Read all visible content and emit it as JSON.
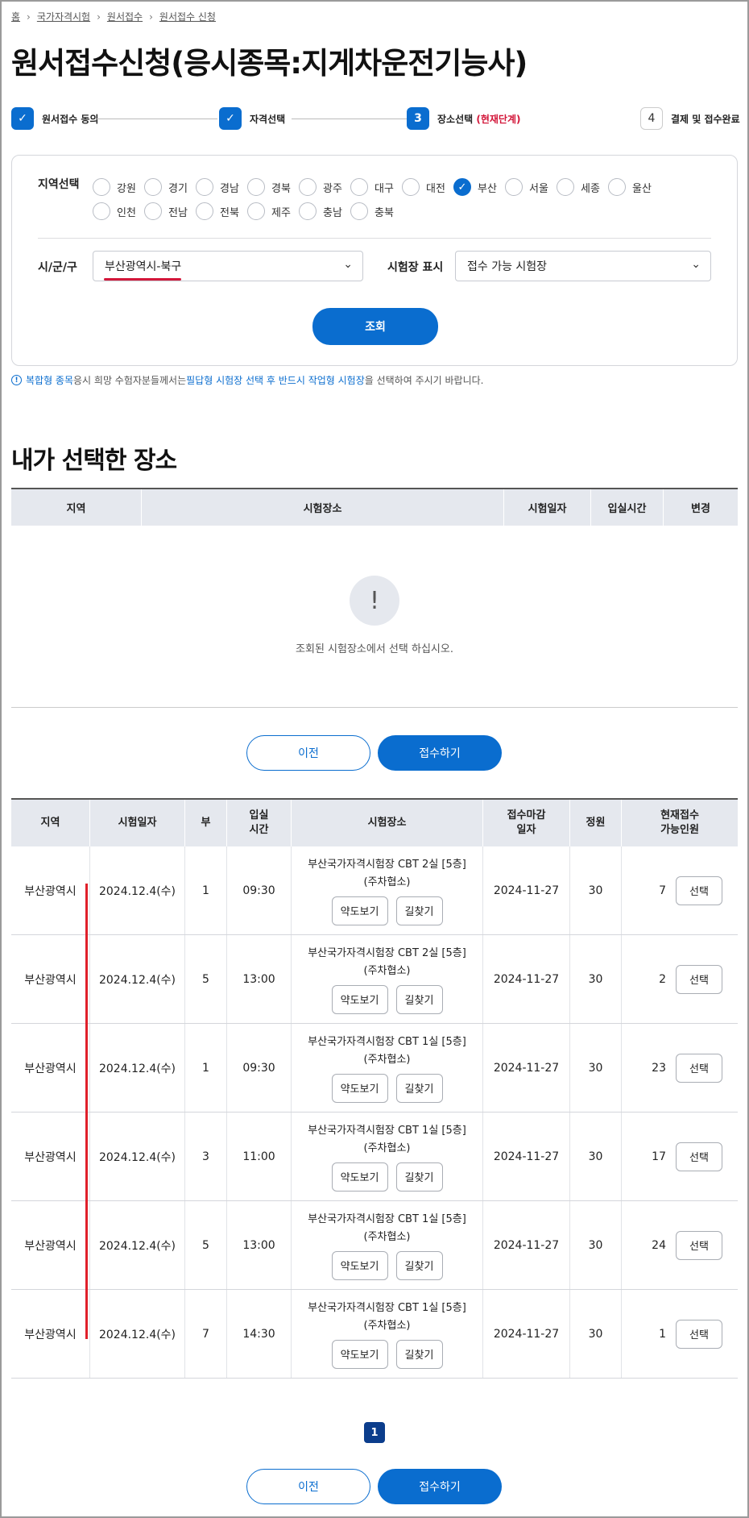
{
  "breadcrumb": [
    "홈",
    "국가자격시험",
    "원서접수",
    "원서접수 신청"
  ],
  "page_title": "원서접수신청(응시종목:지게차운전기능사)",
  "steps": [
    {
      "num": "✓",
      "label": "원서접수 동의",
      "state": "done"
    },
    {
      "num": "✓",
      "label": "자격선택",
      "state": "done"
    },
    {
      "num": "3",
      "label": "장소선택",
      "current": "(현재단계)",
      "state": "current"
    },
    {
      "num": "4",
      "label": "결제 및 접수완료",
      "state": "todo"
    }
  ],
  "filter": {
    "region_label": "지역선택",
    "regions_row1": [
      "강원",
      "경기",
      "경남",
      "경북",
      "광주",
      "대구",
      "대전",
      "부산",
      "서울",
      "세종",
      "울산"
    ],
    "regions_row2": [
      "인천",
      "전남",
      "전북",
      "제주",
      "충남",
      "충북"
    ],
    "selected_region": "부산",
    "district_label": "시/군/구",
    "district_value": "부산광역시-북구",
    "site_label": "시험장 표시",
    "site_value": "접수 가능 시험장",
    "search_button": "조회"
  },
  "notice": {
    "part1": "복합형 종목",
    "part2": " 응시 희망 수험자분들께서는 ",
    "part3": "필답형 시험장 선택 후 반드시 작업형 시험장",
    "part4": "을 선택하여 주시기 바랍니다."
  },
  "selected_section": {
    "title": "내가 선택한 장소",
    "columns": [
      "지역",
      "시험장소",
      "시험일자",
      "입실시간",
      "변경"
    ],
    "empty_icon": "!",
    "empty_text": "조회된 시험장소에서 선택 하십시오."
  },
  "nav": {
    "prev": "이전",
    "submit": "접수하기"
  },
  "results": {
    "columns": [
      "지역",
      "시험일자",
      "부",
      "입실\n시간",
      "시험장소",
      "접수마감\n일자",
      "정원",
      "현재접수\n가능인원"
    ],
    "map_button": "약도보기",
    "route_button": "길찾기",
    "select_button": "선택",
    "rows": [
      {
        "region": "부산광역시",
        "date": "2024.12.4(수)",
        "part": "1",
        "time": "09:30",
        "place1": "부산국가자격시험장 CBT 2실 [5층]",
        "place2": "(주차협소)",
        "deadline": "2024-11-27",
        "capacity": "30",
        "available": "7"
      },
      {
        "region": "부산광역시",
        "date": "2024.12.4(수)",
        "part": "5",
        "time": "13:00",
        "place1": "부산국가자격시험장 CBT 2실 [5층]",
        "place2": "(주차협소)",
        "deadline": "2024-11-27",
        "capacity": "30",
        "available": "2"
      },
      {
        "region": "부산광역시",
        "date": "2024.12.4(수)",
        "part": "1",
        "time": "09:30",
        "place1": "부산국가자격시험장 CBT 1실 [5층]",
        "place2": "(주차협소)",
        "deadline": "2024-11-27",
        "capacity": "30",
        "available": "23"
      },
      {
        "region": "부산광역시",
        "date": "2024.12.4(수)",
        "part": "3",
        "time": "11:00",
        "place1": "부산국가자격시험장 CBT 1실 [5층]",
        "place2": "(주차협소)",
        "deadline": "2024-11-27",
        "capacity": "30",
        "available": "17"
      },
      {
        "region": "부산광역시",
        "date": "2024.12.4(수)",
        "part": "5",
        "time": "13:00",
        "place1": "부산국가자격시험장 CBT 1실 [5층]",
        "place2": "(주차협소)",
        "deadline": "2024-11-27",
        "capacity": "30",
        "available": "24"
      },
      {
        "region": "부산광역시",
        "date": "2024.12.4(수)",
        "part": "7",
        "time": "14:30",
        "place1": "부산국가자격시험장 CBT 1실 [5층]",
        "place2": "(주차협소)",
        "deadline": "2024-11-27",
        "capacity": "30",
        "available": "1"
      }
    ]
  },
  "pagination": {
    "current": "1"
  },
  "colors": {
    "accent": "#0a6dcf",
    "current_step": "#d3173a",
    "highlight": "#e0202a",
    "pager": "#0b3d8c"
  }
}
